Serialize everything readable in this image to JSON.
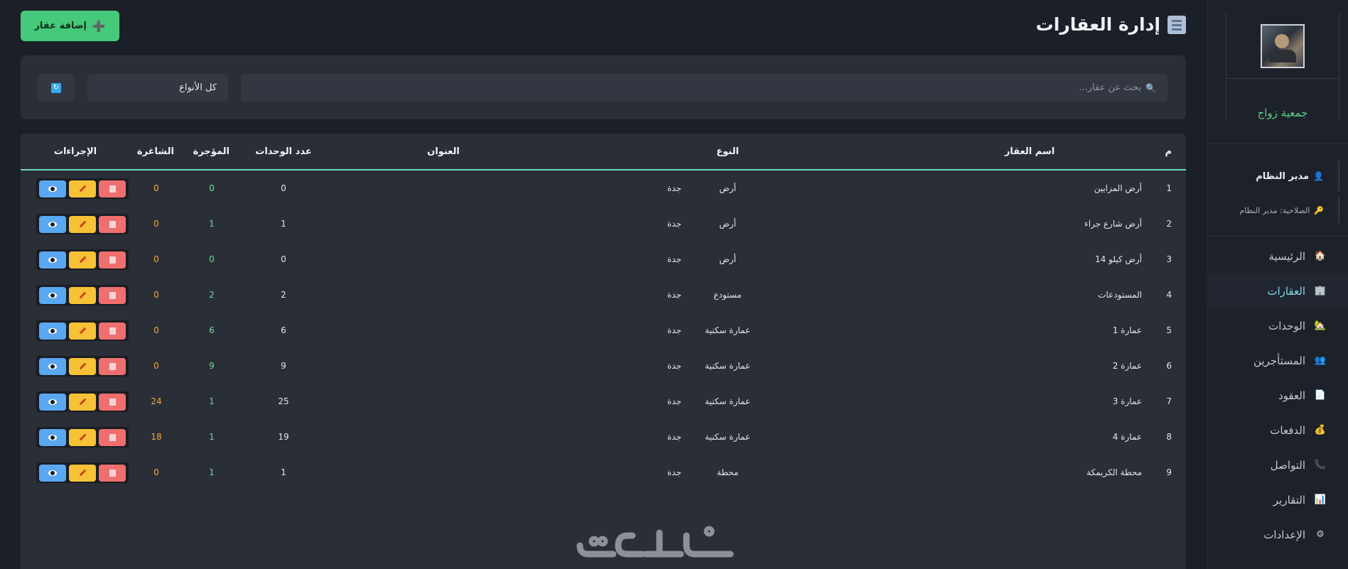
{
  "org": {
    "name": "جمعية زواج"
  },
  "user": {
    "name": "مدير النظام",
    "role": "الصلاحية: مدير النظام"
  },
  "nav": [
    {
      "label": "الرئيسية",
      "icon": "home-icon"
    },
    {
      "label": "العقارات",
      "icon": "building-icon",
      "active": true
    },
    {
      "label": "الوحدات",
      "icon": "house-icon"
    },
    {
      "label": "المستأجرين",
      "icon": "users-icon"
    },
    {
      "label": "العقود",
      "icon": "document-icon"
    },
    {
      "label": "الدفعات",
      "icon": "money-bag-icon"
    },
    {
      "label": "التواصل",
      "icon": "phone-icon"
    },
    {
      "label": "التقارير",
      "icon": "chart-icon"
    },
    {
      "label": "الإعدادات",
      "icon": "gear-icon"
    }
  ],
  "page": {
    "title": "إدارة العقارات",
    "add_label": "إضافة عقار"
  },
  "filters": {
    "search_placeholder": "بحث عن عقار...",
    "type_value": "كل الأنواع"
  },
  "table": {
    "headers": {
      "num": "م",
      "name": "اسم العقار",
      "type": "النوع",
      "address": "العنوان",
      "units": "عدد الوحدات",
      "rented": "المؤجرة",
      "vacant": "الشاغرة",
      "actions": "الإجراءات"
    },
    "rows": [
      {
        "num": "1",
        "name": "أرض المزايين",
        "type": "أرض",
        "address": "جدة",
        "units": "0",
        "rented": "0",
        "vacant": "0"
      },
      {
        "num": "2",
        "name": "أرض شارع جراء",
        "type": "أرض",
        "address": "جدة",
        "units": "1",
        "rented": "1",
        "vacant": "0"
      },
      {
        "num": "3",
        "name": "أرض كيلو 14",
        "type": "أرض",
        "address": "جدة",
        "units": "0",
        "rented": "0",
        "vacant": "0"
      },
      {
        "num": "4",
        "name": "المستودعات",
        "type": "مستودع",
        "address": "جدة",
        "units": "2",
        "rented": "2",
        "vacant": "0"
      },
      {
        "num": "5",
        "name": "عمارة 1",
        "type": "عمارة سكنية",
        "address": "جدة",
        "units": "6",
        "rented": "6",
        "vacant": "0"
      },
      {
        "num": "6",
        "name": "عمارة 2",
        "type": "عمارة سكنية",
        "address": "جدة",
        "units": "9",
        "rented": "9",
        "vacant": "0"
      },
      {
        "num": "7",
        "name": "عمارة 3",
        "type": "عمارة سكنية",
        "address": "جدة",
        "units": "25",
        "rented": "1",
        "vacant": "24"
      },
      {
        "num": "8",
        "name": "عمارة 4",
        "type": "عمارة سكنية",
        "address": "جدة",
        "units": "19",
        "rented": "1",
        "vacant": "18"
      },
      {
        "num": "9",
        "name": "محطة الكريمكة",
        "type": "محطة",
        "address": "جدة",
        "units": "1",
        "rented": "1",
        "vacant": "0"
      }
    ]
  },
  "watermark": {
    "text": "خمسات"
  },
  "colors": {
    "accent": "#45c97a",
    "active_nav": "#7fd7e0",
    "rented": "#6fd99a",
    "vacant": "#f0a93a",
    "header_line": "#6fd9c7"
  }
}
